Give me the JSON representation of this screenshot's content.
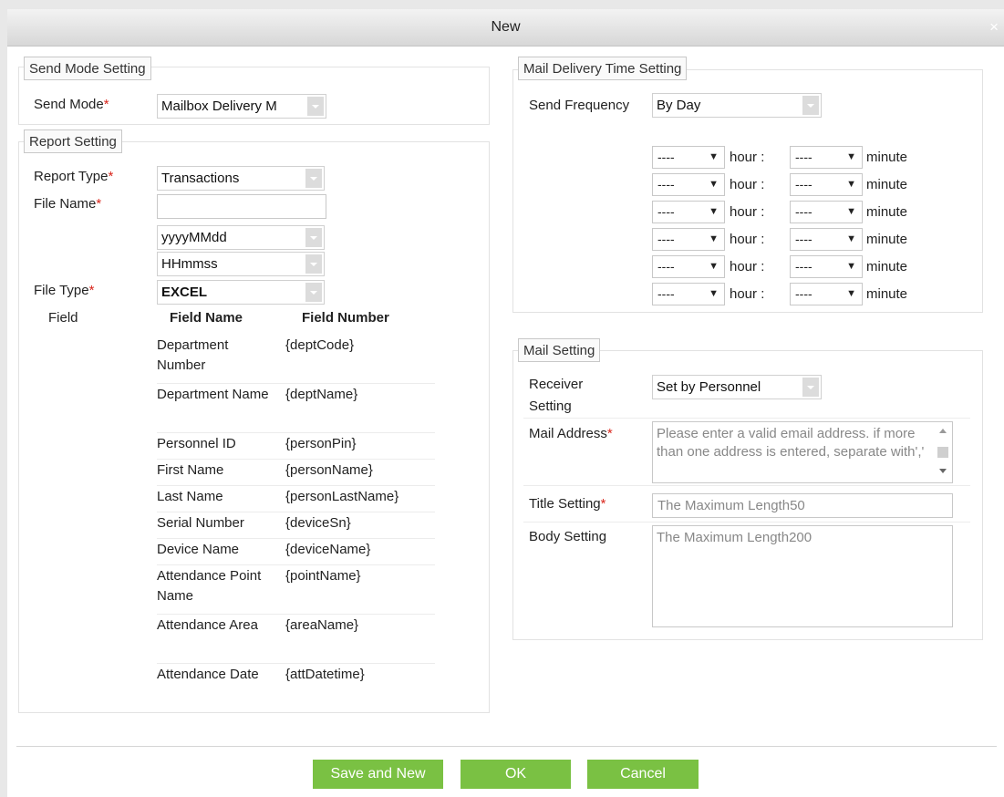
{
  "dialog": {
    "title": "New",
    "close": "×"
  },
  "send_mode": {
    "legend": "Send Mode Setting",
    "label": "Send Mode",
    "value": "Mailbox Delivery M"
  },
  "report": {
    "legend": "Report Setting",
    "type_label": "Report Type",
    "type_value": "Transactions",
    "file_label": "File Name",
    "file_value": "",
    "date_format": "yyyyMMdd",
    "time_format": "HHmmss",
    "filetype_label": "File Type",
    "filetype_value": "EXCEL",
    "field_label": "Field",
    "col_name": "Field Name",
    "col_number": "Field Number",
    "fields": [
      {
        "name": "Department Number",
        "code": "{deptCode}"
      },
      {
        "name": "Department Name",
        "code": "{deptName}"
      },
      {
        "name": "Personnel ID",
        "code": "{personPin}"
      },
      {
        "name": "First Name",
        "code": "{personName}"
      },
      {
        "name": "Last Name",
        "code": "{personLastName}"
      },
      {
        "name": "Serial Number",
        "code": "{deviceSn}"
      },
      {
        "name": "Device Name",
        "code": "{deviceName}"
      },
      {
        "name": "Attendance Point Name",
        "code": "{pointName}"
      },
      {
        "name": "Attendance Area",
        "code": "{areaName}"
      },
      {
        "name": "Attendance Date",
        "code": "{attDatetime}"
      }
    ]
  },
  "delivery": {
    "legend": "Mail Delivery Time Setting",
    "freq_label": "Send Frequency",
    "freq_value": "By Day",
    "hour_text": "hour :",
    "minute_text": "minute",
    "times": [
      {
        "hour": "----",
        "minute": "----"
      },
      {
        "hour": "----",
        "minute": "----"
      },
      {
        "hour": "----",
        "minute": "----"
      },
      {
        "hour": "----",
        "minute": "----"
      },
      {
        "hour": "----",
        "minute": "----"
      },
      {
        "hour": "----",
        "minute": "----"
      }
    ]
  },
  "mail": {
    "legend": "Mail Setting",
    "receiver_label": "Receiver Setting",
    "receiver_value": "Set by Personnel",
    "address_label": "Mail Address",
    "address_placeholder": "Please enter a valid email address. if more than one address is entered, separate with','",
    "title_label": "Title Setting",
    "title_placeholder": "The Maximum Length50",
    "body_label": "Body Setting",
    "body_placeholder": "The Maximum Length200"
  },
  "buttons": {
    "save_new": "Save and New",
    "ok": "OK",
    "cancel": "Cancel"
  },
  "colors": {
    "accent": "#7ac143",
    "required": "#d9261c",
    "titlebar": "#d9d9d9"
  }
}
